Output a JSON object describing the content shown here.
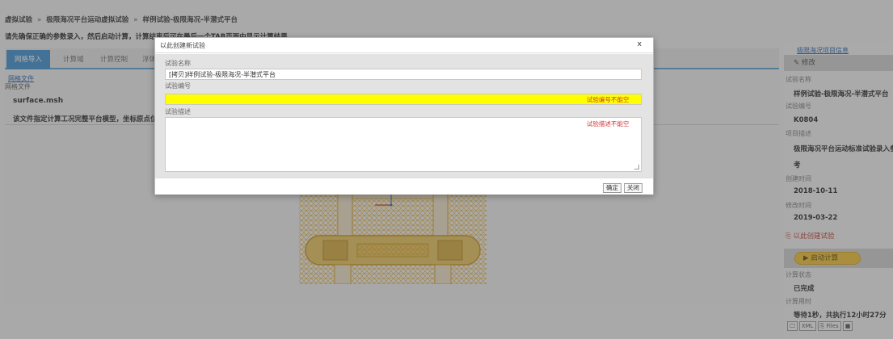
{
  "breadcrumb": [
    "虚拟试验",
    "极限海况平台运动虚拟试验",
    "样例试验-极限海况-半潜式平台"
  ],
  "breadcrumb_sep": "»",
  "notice": "请先确保正确的参数录入，然后启动计算，计算结束后可在最后一个TAB页面中显示计算结果",
  "tabs": [
    "网格导入",
    "计算域",
    "计算控制",
    "浮体"
  ],
  "left_panel": {
    "link": "网格文件",
    "label": "网格文件",
    "file": "surface.msh",
    "desc": "该文件指定计算工况完整平台模型，坐标原点位于"
  },
  "sidebar": {
    "title": "极限海况项目信息",
    "edit_button": "修改",
    "name_label": "试验名称",
    "name_value": "样例试验-极限海况-半潜式平台",
    "id_label": "试验编号",
    "id_value": "K0804",
    "project_label": "项目描述",
    "project_value_1": "极限海况平台运动标准试验录入参",
    "project_value_2": "考",
    "created_label": "创建时间",
    "created_value": "2018-10-11",
    "modified_label": "修改时间",
    "modified_value": "2019-03-22",
    "create_link": "以此创建试验",
    "run_button": "启动计算",
    "status_label": "计算状态",
    "status_value": "已完成",
    "time_label": "计算用时",
    "time_value": "等待1秒，共执行12小时27分",
    "tool_xml": "XML",
    "tool_files": "Files"
  },
  "dialog": {
    "title": "以此创建新试验",
    "close": "x",
    "name_label": "试验名称",
    "name_value": "[拷贝]样例试验-极限海况-半潜式平台",
    "id_label": "试验编号",
    "id_value": "",
    "id_error": "试验编号不能空",
    "desc_label": "试验描述",
    "desc_error": "试验描述不能空",
    "confirm": "确定",
    "close_button": "关闭"
  },
  "colors": {
    "accent": "#3a8fd0",
    "error_field": "#ffff00",
    "error_text": "#d23a3a",
    "mesh": "#e2a51c",
    "run_button": "#f2c230"
  }
}
